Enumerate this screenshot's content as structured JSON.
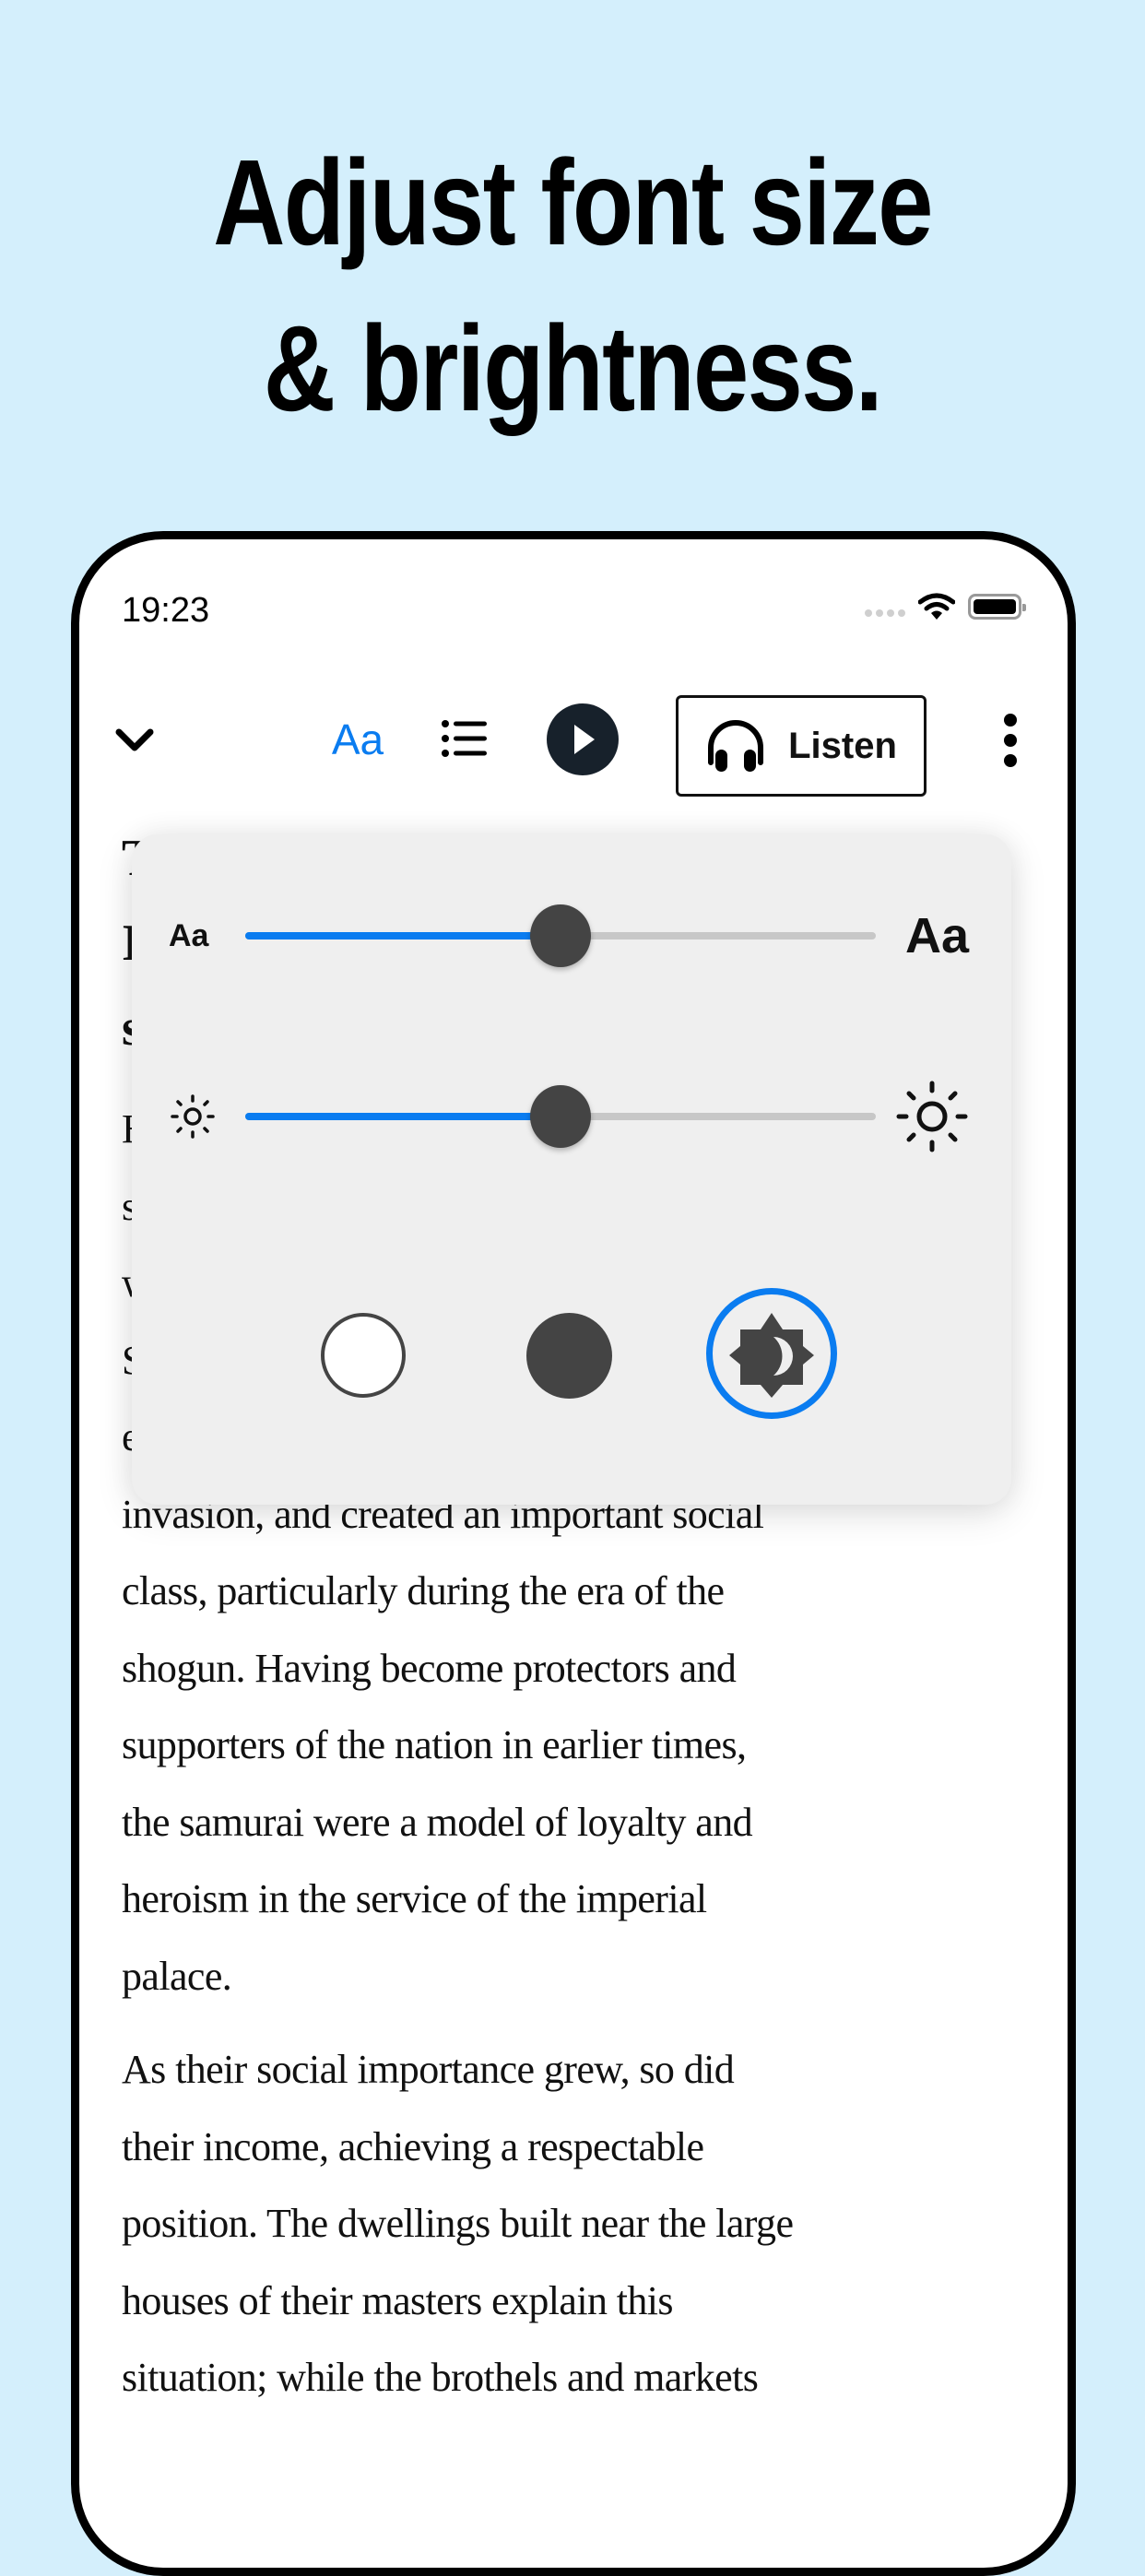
{
  "headline": {
    "line1": "Adjust font size",
    "line2": "& brightness."
  },
  "status_bar": {
    "time": "19:23",
    "icons": [
      "signal-icon",
      "wifi-icon",
      "battery-icon"
    ]
  },
  "toolbar": {
    "collapse_icon": "chevron-down-icon",
    "font_settings_label": "Aa",
    "font_settings_color": "#0a7cf0",
    "toc_icon": "list-icon",
    "play_icon": "play-icon",
    "listen_label": "Listen",
    "listen_icon": "headphones-icon",
    "more_icon": "more-vertical-icon"
  },
  "reader_settings": {
    "font_size": {
      "min_label": "Aa",
      "max_label": "Aa",
      "value": 0.5
    },
    "brightness": {
      "min_icon": "sun-small-icon",
      "max_icon": "sun-large-icon",
      "value": 0.5
    },
    "themes": [
      {
        "name": "light",
        "selected": false
      },
      {
        "name": "dark",
        "selected": false
      },
      {
        "name": "auto",
        "selected": true
      }
    ],
    "accent_color": "#0a7cf0"
  },
  "article": {
    "title_lines": [
      "T",
      "I",
      "s"
    ],
    "paragraphs": [
      "H                                                   s                                                   w                                                   S                                                   especially after repelling the Mongol invasion, and created an important social class, particularly during the era of the shogun. Having become protectors and supporters of the nation in earlier times, the samurai were a model of loyalty and heroism in the service of the imperial palace.",
      "As their social importance grew, so did their income, achieving a respectable position. The dwellings built near the large houses of their masters explain this situation; while the brothels and markets"
    ],
    "visible_lines_p1": [
      "especially after repelling the Mongol",
      "invasion, and created an important social",
      "class, particularly during the era of the",
      "shogun. Having become protectors and",
      "supporters of the nation in earlier times,",
      "the samurai were a model of loyalty and",
      "heroism in the service of the imperial",
      "palace."
    ],
    "visible_lines_p2": [
      "As their social importance grew, so did",
      "their income, achieving a respectable",
      "position. The dwellings built near the large",
      "houses of their masters explain this",
      "situation; while the brothels and markets"
    ],
    "hidden_line_starts": [
      "H",
      "s",
      "w",
      "S"
    ]
  }
}
